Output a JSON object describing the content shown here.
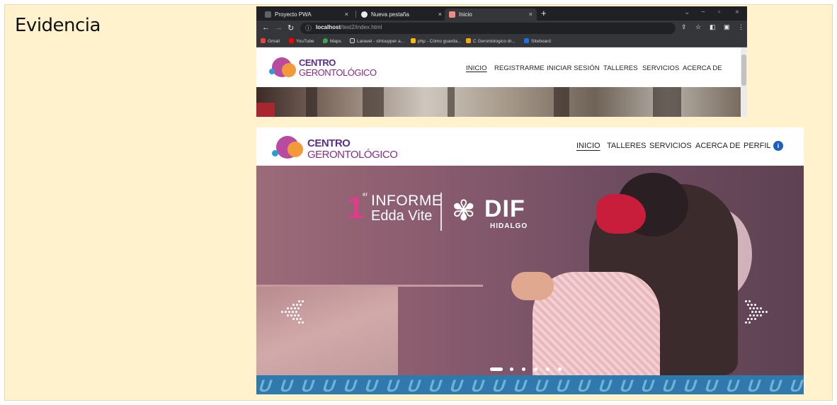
{
  "doc": {
    "title": "Evidencia"
  },
  "browser": {
    "tabs": [
      {
        "label": "Proyecto PWA",
        "color": "#5f6368"
      },
      {
        "label": "Nueva pestaña",
        "color": "#e8eaed"
      },
      {
        "label": "Inicio",
        "color": "#f28b82"
      }
    ],
    "new_tab": "+",
    "window_controls": {
      "minimize": "−",
      "restore": "▫",
      "close": "×"
    },
    "url_host": "localhost",
    "url_path": "/test2/index.html",
    "bookmarks": [
      {
        "label": "Gmail",
        "color": "#ea4335"
      },
      {
        "label": "YouTube",
        "color": "#ff0000"
      },
      {
        "label": "Maps",
        "color": "#34a853"
      },
      {
        "label": "Laravel - strtoupper a...",
        "color": "#3c4043"
      },
      {
        "label": "php - Cómo guarda...",
        "color": "#fbbc04"
      },
      {
        "label": "C Gerontologico dr...",
        "color": "#f9ab00"
      },
      {
        "label": "Siteboard",
        "color": "#1a73e8"
      }
    ]
  },
  "site1": {
    "logo_line1": "CENTRO",
    "logo_line2": "GERONTOLÓGICO",
    "menu": [
      "INICIO",
      "REGISTRARME",
      "INICIAR SESIÓN",
      "TALLERES",
      "SERVICIOS",
      "ACERCA DE"
    ]
  },
  "site2": {
    "logo_line1": "CENTRO",
    "logo_line2": "GERONTOLÓGICO",
    "menu": [
      "INICIO",
      "TALLERES",
      "SERVICIOS",
      "ACERCA DE",
      "PERFIL"
    ],
    "banner": {
      "num": "1",
      "sup": "er",
      "line1": "INFORME",
      "line2": "Edda Vite",
      "brand": "DIF",
      "brand_sub": "HIDALGO"
    },
    "carousel": {
      "slides": 6,
      "active": 1
    }
  },
  "colors": {
    "accent": "#5b2d8e",
    "pink": "#e23b8c",
    "hero": "#8e5f70",
    "strip": "#2f79ad"
  }
}
